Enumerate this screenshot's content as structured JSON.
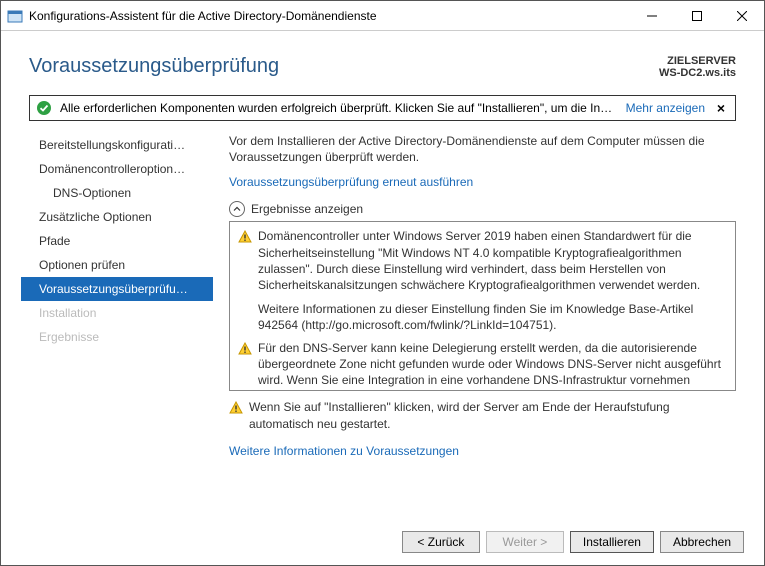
{
  "window": {
    "title": "Konfigurations-Assistent für die Active Directory-Domänendienste"
  },
  "header": {
    "page_title": "Voraussetzungsüberprüfung",
    "target_label": "ZIELSERVER",
    "target_name": "WS-DC2.ws.its"
  },
  "banner": {
    "text": "Alle erforderlichen Komponenten wurden erfolgreich überprüft. Klicken Sie auf \"Installieren\", um die Inst…",
    "more": "Mehr anzeigen"
  },
  "sidebar": {
    "items": [
      {
        "label": "Bereitstellungskonfigurati…",
        "indent": false,
        "active": false,
        "disabled": false
      },
      {
        "label": "Domänencontrolleroption…",
        "indent": false,
        "active": false,
        "disabled": false
      },
      {
        "label": "DNS-Optionen",
        "indent": true,
        "active": false,
        "disabled": false
      },
      {
        "label": "Zusätzliche Optionen",
        "indent": false,
        "active": false,
        "disabled": false
      },
      {
        "label": "Pfade",
        "indent": false,
        "active": false,
        "disabled": false
      },
      {
        "label": "Optionen prüfen",
        "indent": false,
        "active": false,
        "disabled": false
      },
      {
        "label": "Voraussetzungsüberprüfu…",
        "indent": false,
        "active": true,
        "disabled": false
      },
      {
        "label": "Installation",
        "indent": false,
        "active": false,
        "disabled": true
      },
      {
        "label": "Ergebnisse",
        "indent": false,
        "active": false,
        "disabled": true
      }
    ]
  },
  "main": {
    "lead": "Vor dem Installieren der Active Directory-Domänendienste auf dem Computer müssen die Voraussetzungen überprüft werden.",
    "rerun_link": "Voraussetzungsüberprüfung erneut ausführen",
    "group_title": "Ergebnisse anzeigen",
    "results": [
      {
        "text": "Domänencontroller unter Windows Server 2019 haben einen Standardwert für die Sicherheitseinstellung \"Mit Windows NT 4.0 kompatible Kryptografiealgorithmen zulassen\". Durch diese Einstellung wird verhindert, dass beim Herstellen von Sicherheitskanalsitzungen schwächere Kryptografiealgorithmen verwendet werden.",
        "extra": "Weitere Informationen zu dieser Einstellung finden Sie im Knowledge Base-Artikel 942564 (http://go.microsoft.com/fwlink/?LinkId=104751)."
      },
      {
        "text": "Für den DNS-Server kann keine Delegierung erstellt werden, da die autorisierende übergeordnete Zone nicht gefunden wurde oder Windows DNS-Server nicht ausgeführt wird. Wenn Sie eine Integration in eine vorhandene DNS-Infrastruktur vornehmen"
      }
    ],
    "note": "Wenn Sie auf \"Installieren\" klicken, wird der Server am Ende der Heraufstufung automatisch neu gestartet.",
    "more_info_link": "Weitere Informationen zu Voraussetzungen"
  },
  "buttons": {
    "back": "< Zurück",
    "next": "Weiter >",
    "install": "Installieren",
    "cancel": "Abbrechen"
  }
}
